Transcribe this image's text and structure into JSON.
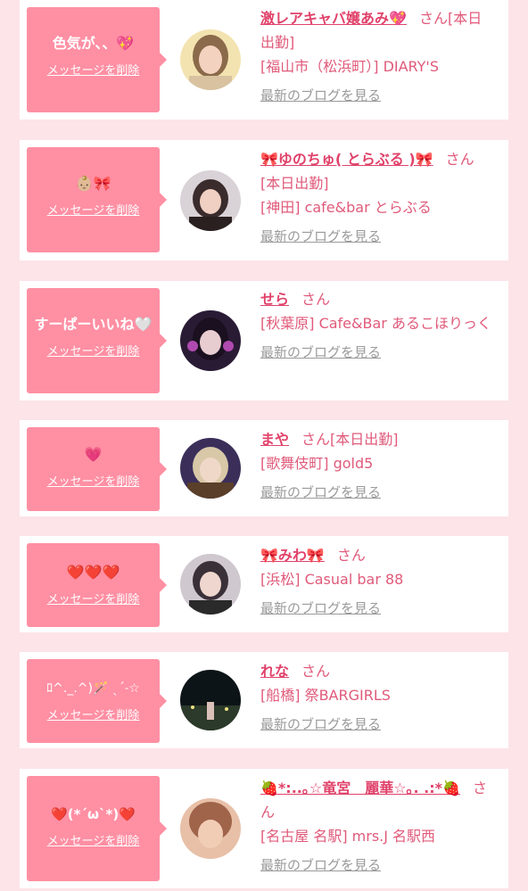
{
  "common": {
    "delete_label": "メッセージを削除",
    "blog_label": "最新のブログを見る",
    "san": "さん"
  },
  "cards": [
    {
      "message": "色気が、、💖",
      "name": "激レアキャバ嬢あみ💖",
      "tag": "[本日出勤]",
      "shop": "[福山市（松浜町）] DIARY'S",
      "avatar": {
        "top": "#f3e3b0",
        "bottom": "#8a6a4a",
        "skin": "#f4d2c0"
      }
    },
    {
      "message": "👶🏼🎀",
      "name": "🎀ゆのちゅ( とらぶる )🎀",
      "tag": "[本日出勤]",
      "shop": "[神田] cafe&bar とらぶる",
      "avatar": {
        "top": "#d9d2d6",
        "bottom": "#3a2b2c",
        "skin": "#f0d0c2"
      }
    },
    {
      "message": "すーぱーいいね🤍",
      "name": "せら",
      "tag": "",
      "shop": "[秋葉原] Cafe&Bar あるこほりっく",
      "avatar": {
        "top": "#2a1b35",
        "bottom": "#6a2a6a",
        "skin": "#e7ccd0"
      }
    },
    {
      "message": "💗",
      "name": "まや",
      "tag": "[本日出勤]",
      "shop": "[歌舞伎町] gold5",
      "avatar": {
        "top": "#3b2f5a",
        "bottom": "#5a3f2a",
        "skin": "#f0d8c8"
      }
    },
    {
      "message": "❤️❤️❤️",
      "name": "🎀みわ🎀",
      "tag": "",
      "shop": "[浜松] Casual bar 88",
      "avatar": {
        "top": "#cfc8cf",
        "bottom": "#2a2a2a",
        "skin": "#efd7cf"
      }
    },
    {
      "message": "ﾛ^._.^)🪄 ˎˊ˗☆",
      "name": "れな",
      "tag": "",
      "shop": "[船橋] 祭BARGIRLS",
      "avatar": {
        "top": "#0d1418",
        "bottom": "#2b3a2a",
        "skin": "#d9c0b8"
      }
    },
    {
      "message": "❤️(*´ω`*)❤️",
      "name": "🍓*:..｡☆竜宮　麗華☆｡. .:*🍓",
      "tag": "",
      "shop": "[名古屋 名駅] mrs.J 名駅西",
      "avatar": {
        "top": "#a0644a",
        "bottom": "#e8c0a8",
        "skin": "#f2cdb6"
      }
    }
  ]
}
